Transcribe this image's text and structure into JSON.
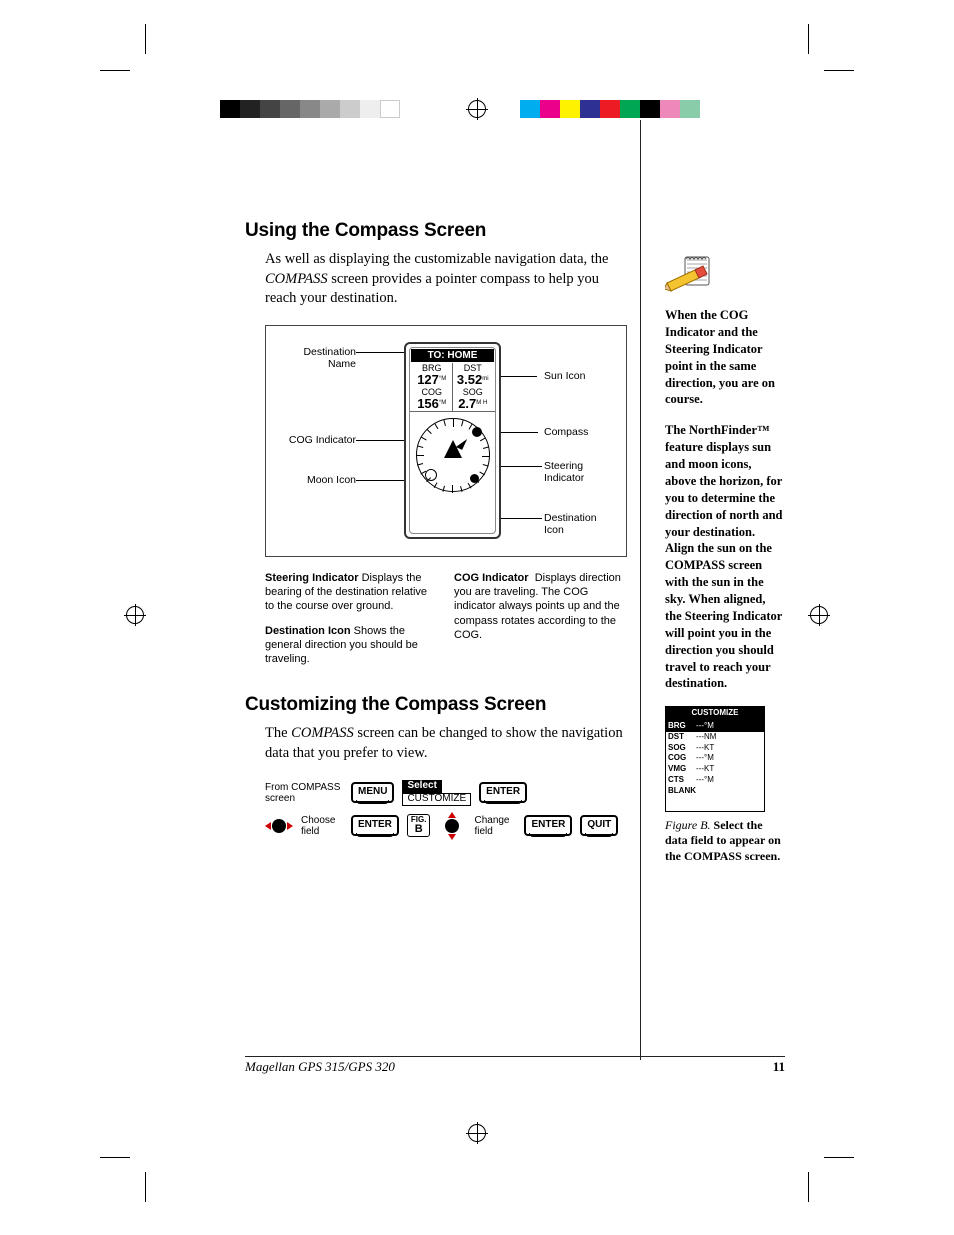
{
  "heading1": "Using the Compass Screen",
  "intro1_a": "As well as displaying the customizable navigation data, the ",
  "intro1_b": "COMPASS",
  "intro1_c": " screen provides a pointer compass to help you reach your destination.",
  "figure": {
    "to_label": "TO: HOME",
    "brg_label": "BRG",
    "brg_value": "127",
    "brg_unit": "°M",
    "dst_label": "DST",
    "dst_value": "3.52",
    "dst_unit": "mi",
    "cog_label": "COG",
    "cog_value": "156",
    "cog_unit": "°M",
    "sog_label": "SOG",
    "sog_value": "2.7",
    "sog_unit": "M H"
  },
  "callouts": {
    "dest_name": "Destination Name",
    "cog_ind": "COG Indicator",
    "moon": "Moon Icon",
    "sun": "Sun Icon",
    "compass": "Compass",
    "steer": "Steering Indicator",
    "dest_icon": "Destination Icon"
  },
  "defs": {
    "steer_title": "Steering Indicator",
    "steer_body": "Displays the bearing of the destination relative to the course over ground.",
    "dest_title": "Destination Icon",
    "dest_body": "Shows the general direction you should be traveling.",
    "cog_title": "COG Indicator",
    "cog_body": "Displays direction you are traveling. The COG indicator always points up and the compass rotates according to the COG."
  },
  "heading2": "Customizing the Compass Screen",
  "intro2_a": "The ",
  "intro2_b": "COMPASS",
  "intro2_c": " screen can be changed to show the navigation data that you prefer to view.",
  "seq": {
    "from": "From COMPASS screen",
    "menu": "MENU",
    "select": "Select",
    "customize": "CUSTOMIZE",
    "enter": "ENTER",
    "choose": "Choose field",
    "figb": "FIG. B",
    "change": "Change field",
    "quit": "QUIT"
  },
  "sidebar": {
    "note1": "When the COG Indicator and the Steering Indicator point in the same direction, you are on course.",
    "note2_a": "The ",
    "note2_b": "NorthFinder™",
    "note2_c": " feature displays sun and moon icons, above the horizon, for you to determine the direction of north and your destination.  Align the sun on the COMPASS screen with the sun in the sky.  When aligned, the Steering Indicator will point you in the direction you should travel to reach your destination."
  },
  "figureB": {
    "header": "CUSTOMIZE",
    "rows": [
      {
        "a": "BRG",
        "b": "---°M",
        "sel": true
      },
      {
        "a": "DST",
        "b": "---NM",
        "sel": false
      },
      {
        "a": "SOG",
        "b": "---KT",
        "sel": false
      },
      {
        "a": "COG",
        "b": "---°M",
        "sel": false
      },
      {
        "a": "VMG",
        "b": "---KT",
        "sel": false
      },
      {
        "a": "CTS",
        "b": "---°M",
        "sel": false
      },
      {
        "a": "BLANK",
        "b": "",
        "sel": false
      }
    ],
    "caption_a": "Figure B.",
    "caption_b": " Select the data field to appear on the COMPASS screen."
  },
  "footer": {
    "product": "Magellan GPS 315/GPS 320",
    "page": "11"
  }
}
